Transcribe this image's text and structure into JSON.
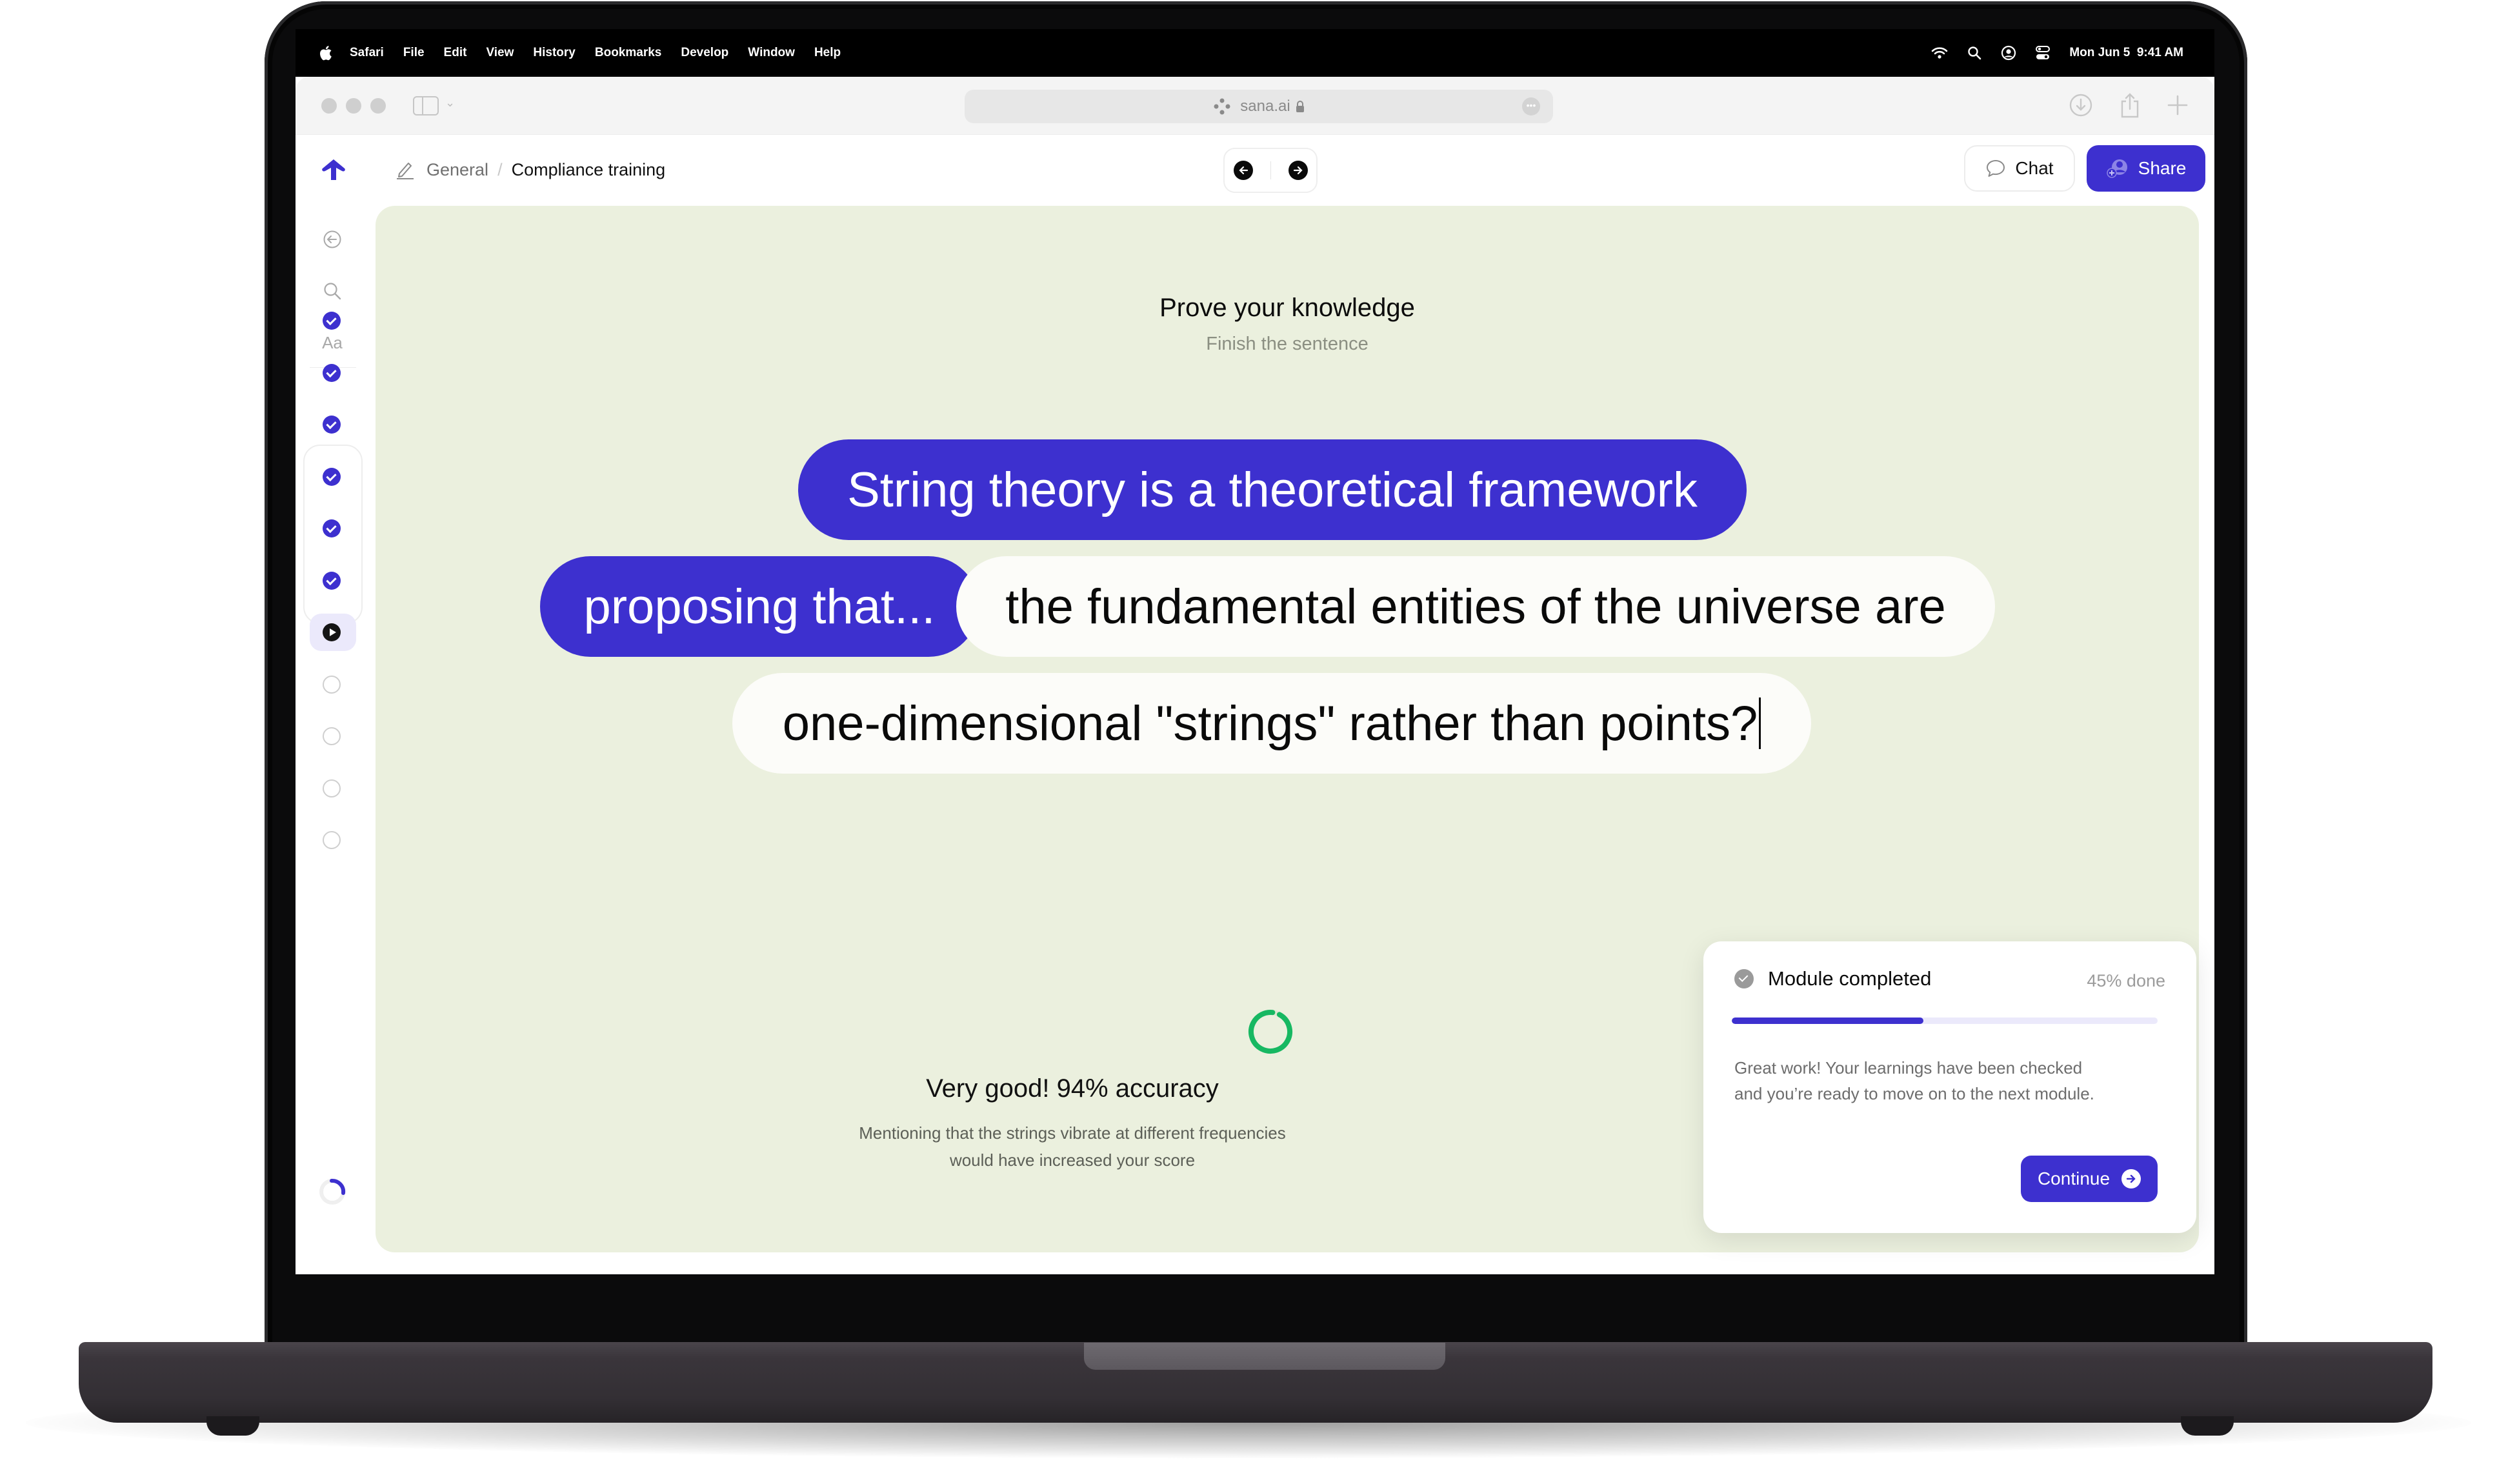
{
  "menubar": {
    "app_name": "Safari",
    "items": [
      "File",
      "Edit",
      "View",
      "History",
      "Bookmarks",
      "Develop",
      "Window",
      "Help"
    ],
    "status_icons": [
      "wifi-icon",
      "spotlight-search-icon",
      "user-account-icon",
      "control-center-icon"
    ],
    "datetime": "Mon Jun 5  9:41 AM"
  },
  "browser": {
    "url": "sana.ai",
    "secure": true,
    "toolbar_icons": [
      "downloads-icon",
      "share-icon",
      "new-tab-icon"
    ]
  },
  "app": {
    "breadcrumb": {
      "parent": "General",
      "separator": "/",
      "current": "Compliance training"
    },
    "nav": {
      "prev_label": "Previous",
      "next_label": "Next"
    },
    "chat_label": "Chat",
    "share_label": "Share",
    "rail": {
      "tools": [
        "back",
        "search",
        "text-style"
      ],
      "text_style_label": "Aa",
      "steps": [
        {
          "state": "done"
        },
        {
          "state": "done"
        },
        {
          "state": "done"
        },
        {
          "state": "done"
        },
        {
          "state": "done"
        },
        {
          "state": "done"
        },
        {
          "state": "current"
        },
        {
          "state": "todo"
        },
        {
          "state": "todo"
        },
        {
          "state": "todo"
        },
        {
          "state": "todo"
        }
      ]
    }
  },
  "quiz": {
    "title": "Prove your knowledge",
    "subtitle": "Finish the sentence",
    "prompt_parts": [
      "String theory is a theoretical framework",
      "proposing that..."
    ],
    "answer_parts": [
      "the fundamental entities of the universe are",
      "one-dimensional \"strings\" rather than points?"
    ]
  },
  "result": {
    "title": "Very good! 94% accuracy",
    "accuracy_percent": 94,
    "feedback_line1": "Mentioning that the strings vibrate at different frequencies",
    "feedback_line2": "would have increased your score"
  },
  "module": {
    "title": "Module completed",
    "progress_label": "45% done",
    "progress_percent": 45,
    "message_line1": "Great work! Your learnings have been checked",
    "message_line2": "and you’re ready to move on to the next module.",
    "continue_label": "Continue"
  },
  "colors": {
    "brand": "#3d30cf",
    "card_bg": "#ebf0de",
    "success": "#17b862"
  }
}
